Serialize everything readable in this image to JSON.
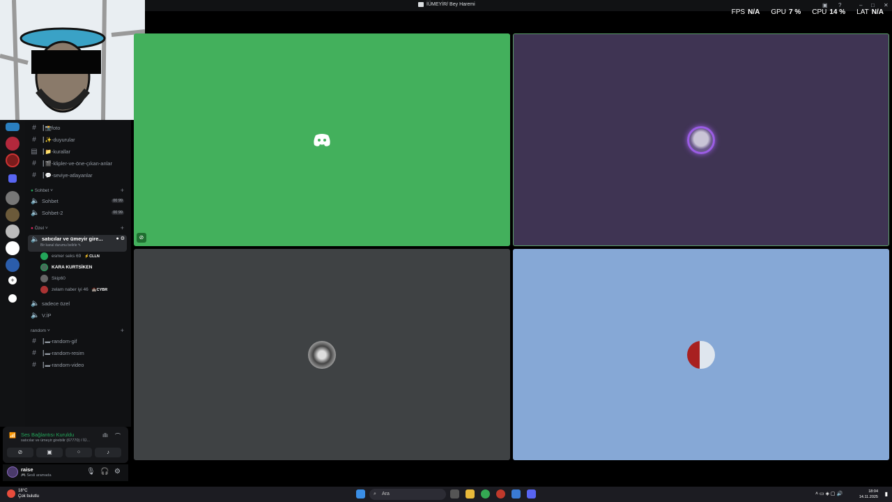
{
  "window": {
    "title": "İÜMEYİR/ Bey Haremi"
  },
  "perf": [
    {
      "label": "FPS",
      "value": "N/A"
    },
    {
      "label": "GPU",
      "value": "7 %"
    },
    {
      "label": "CPU",
      "value": "14 %"
    },
    {
      "label": "LAT",
      "value": "N/A"
    }
  ],
  "channels": {
    "text_top": [
      {
        "name": "┃📸foto"
      },
      {
        "name": "┃✨-duyurular"
      },
      {
        "name": "┃📁-kurallar"
      },
      {
        "name": "┃🎬-klipler-ve-öne-çıkan-anlar"
      },
      {
        "name": "┃💬-seviye-atlayanlar"
      }
    ],
    "cat_sohbet": "Sohbet ˅",
    "voice_sohbet": [
      {
        "name": "Sohbet",
        "count_a": "00",
        "count_b": "99"
      },
      {
        "name": "Sohbet-2",
        "count_a": "00",
        "count_b": "99"
      }
    ],
    "cat_ozel": "Özel ˅",
    "active_voice": "satıcılar ve ümeyir gire...",
    "active_sub": "Bir kanal durumu belirle ✎",
    "members": [
      {
        "name": "esmer seks 69",
        "tag": "⚡CLLN"
      },
      {
        "name": "KARA KURTSİKEN",
        "tag": ""
      },
      {
        "name": "Skip60",
        "tag": ""
      },
      {
        "name": "zelam naber iyi 46",
        "tag": "🏰CYBR"
      }
    ],
    "voice_other": [
      {
        "name": "sadece özel"
      },
      {
        "name": "V.İP"
      }
    ],
    "cat_random": "random ˅",
    "text_random": [
      {
        "name": "┃▬-random-gif"
      },
      {
        "name": "┃▬-random-resim"
      },
      {
        "name": "┃▬-random-video"
      }
    ]
  },
  "voice_panel": {
    "status": "Ses Bağlantısı Kuruldu",
    "channel": "satıcılar ve ümeyir girebilir (67770) / İÜ..."
  },
  "user_panel": {
    "name": "raise",
    "status": "🎮 Sesli aramada"
  },
  "taskbar": {
    "temp": "18°C",
    "weather": "Çok bulutlu",
    "search_placeholder": "Ara",
    "time": "18:04",
    "date": "14.11.2025"
  },
  "colors": {
    "tile1": "#43b05c",
    "tile2": "#3f3453",
    "tile3": "#3f4244",
    "tile4": "#86a8d6",
    "accent": "#5865f2",
    "connected": "#23a55a"
  }
}
